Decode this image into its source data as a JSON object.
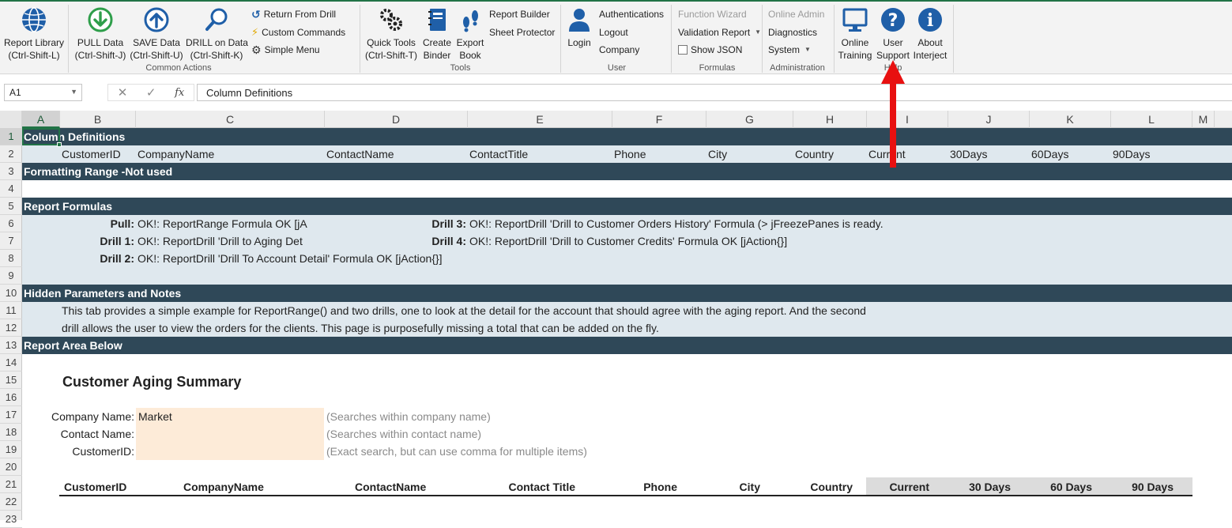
{
  "ribbon": {
    "common_actions": {
      "group_label": "Common Actions",
      "report_library": [
        "Report Library",
        "(Ctrl-Shift-L)"
      ],
      "pull_data": [
        "PULL Data",
        "(Ctrl-Shift-J)"
      ],
      "save_data": [
        "SAVE Data",
        "(Ctrl-Shift-U)"
      ],
      "drill_on_data": [
        "DRILL on Data",
        "(Ctrl-Shift-K)"
      ],
      "return_from_drill": "Return From Drill",
      "custom_commands": "Custom Commands",
      "simple_menu": "Simple Menu"
    },
    "tools": {
      "group_label": "Tools",
      "quick_tools": [
        "Quick Tools",
        "(Ctrl-Shift-T)"
      ],
      "create_binder": [
        "Create",
        "Binder"
      ],
      "export_book": [
        "Export",
        "Book"
      ],
      "report_builder": "Report Builder",
      "sheet_protector": "Sheet Protector"
    },
    "user": {
      "group_label": "User",
      "login": "Login",
      "authentications": "Authentications",
      "logout": "Logout",
      "company": "Company"
    },
    "formulas": {
      "group_label": "Formulas",
      "function_wizard": "Function Wizard",
      "validation_report": "Validation Report",
      "show_json": "Show JSON"
    },
    "administration": {
      "group_label": "Administration",
      "online_admin": "Online Admin",
      "diagnostics": "Diagnostics",
      "system": "System"
    },
    "help": {
      "group_label": "Help",
      "online_training": [
        "Online",
        "Training"
      ],
      "user_support": [
        "User",
        "Support"
      ],
      "about": [
        "About",
        "Interject"
      ]
    }
  },
  "formula_bar": {
    "name_box": "A1",
    "cancel": "✕",
    "enter": "✓",
    "fx": "fx",
    "content": "Column Definitions"
  },
  "columns": [
    "A",
    "B",
    "C",
    "D",
    "E",
    "F",
    "G",
    "H",
    "I",
    "J",
    "L",
    "K",
    "M"
  ],
  "rows": [
    "1",
    "2",
    "3",
    "4",
    "5",
    "6",
    "7",
    "8",
    "9",
    "10",
    "11",
    "12",
    "13",
    "14",
    "15",
    "16",
    "17",
    "18",
    "19",
    "20",
    "21",
    "22",
    "23"
  ],
  "sheet": {
    "r1": "Column Definitions",
    "r2": [
      "CustomerID",
      "CompanyName",
      "ContactName",
      "ContactTitle",
      "Phone",
      "City",
      "Country",
      "Current",
      "30Days",
      "60Days",
      "90Days"
    ],
    "r3": "Formatting Range -Not used",
    "r5": "Report Formulas",
    "pull_label": "Pull:",
    "pull_value": "OK!: ReportRange Formula OK [jA",
    "drill1_label": "Drill 1:",
    "drill1_value": "OK!: ReportDrill 'Drill to Aging Det",
    "drill2_label": "Drill 2:",
    "drill2_value": "OK!: ReportDrill 'Drill To Account Detail' Formula OK [jAction{}]",
    "drill3_label": "Drill 3:",
    "drill3_value": "OK!: ReportDrill 'Drill to Customer Orders History' Formula (> jFreezePanes is ready.",
    "drill4_label": "Drill 4:",
    "drill4_value": "OK!: ReportDrill 'Drill to Customer Credits' Formula OK [jAction{}]",
    "r10": "Hidden Parameters and Notes",
    "r11": "This tab provides a simple example for ReportRange() and two drills, one to look at the detail for the account that should agree with the aging report. And the second",
    "r12": "drill allows the user to view the orders for the clients.   This page is purposefully missing a total that can be added on the fly.",
    "r13": "Report Area Below",
    "report_title": "Customer Aging Summary",
    "filters": {
      "company_label": "Company Name:",
      "company_value": "Market",
      "company_hint": "(Searches within company name)",
      "contact_label": "Contact Name:",
      "contact_value": "",
      "contact_hint": "(Searches within contact name)",
      "customer_label": "CustomerID:",
      "customer_value": "",
      "customer_hint": "(Exact search, but can use comma for multiple items)"
    },
    "table_headers": [
      "CustomerID",
      "CompanyName",
      "ContactName",
      "Contact Title",
      "Phone",
      "City",
      "Country",
      "Current",
      "30 Days",
      "60 Days",
      "90 Days"
    ]
  },
  "colors": {
    "excel_green": "#217346",
    "dark_band": "#2f4858",
    "light_band": "#dfe8ee",
    "input_fill": "#fdebd8",
    "red_arrow": "#e81010"
  }
}
